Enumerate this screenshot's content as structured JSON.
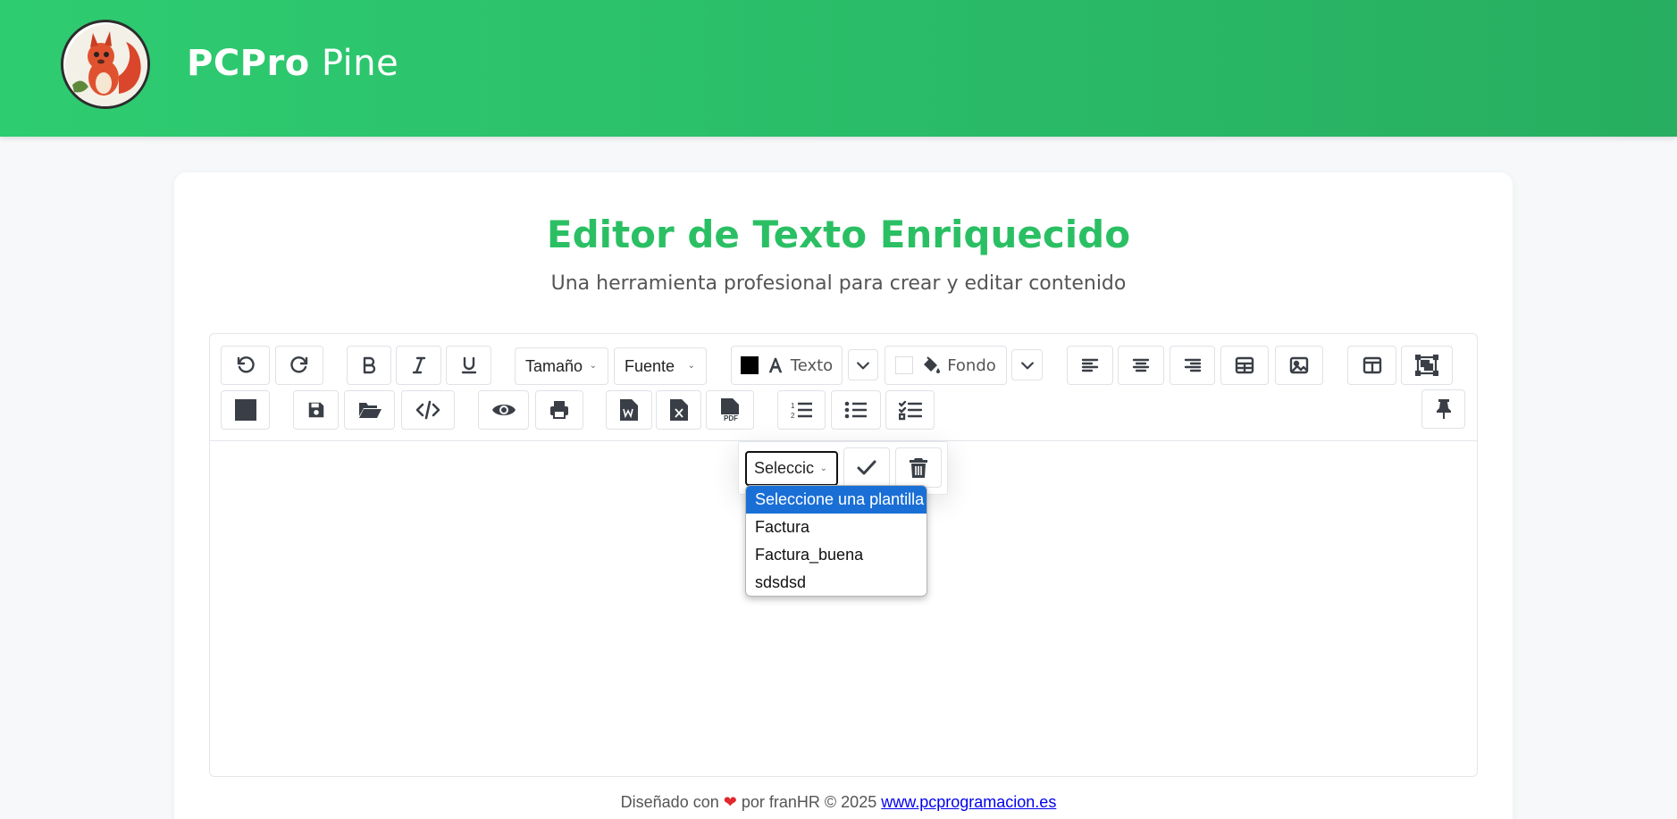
{
  "header": {
    "brand_bold": "PCPro",
    "brand_light": "Pine"
  },
  "main": {
    "title": "Editor de Texto Enriquecido",
    "subtitle": "Una herramienta profesional para crear y editar contenido"
  },
  "toolbar": {
    "size_select": "Tamaño",
    "font_select": "Fuente",
    "text_color_label": "Texto",
    "bg_color_label": "Fondo",
    "text_color": "#000000",
    "bg_color": "#ffffff"
  },
  "template_popup": {
    "select_value": "Seleccic",
    "options": [
      "Seleccione una plantilla",
      "Factura",
      "Factura_buena",
      "sdsdsd"
    ]
  },
  "footer": {
    "prefix": "Diseñado con",
    "middle": "por franHR",
    "copyright": "© 2025",
    "link": "www.pcprogramacion.es"
  },
  "colors": {
    "accent": "#2ecc71",
    "title": "#2bbf64",
    "selection": "#1a6fd6"
  }
}
